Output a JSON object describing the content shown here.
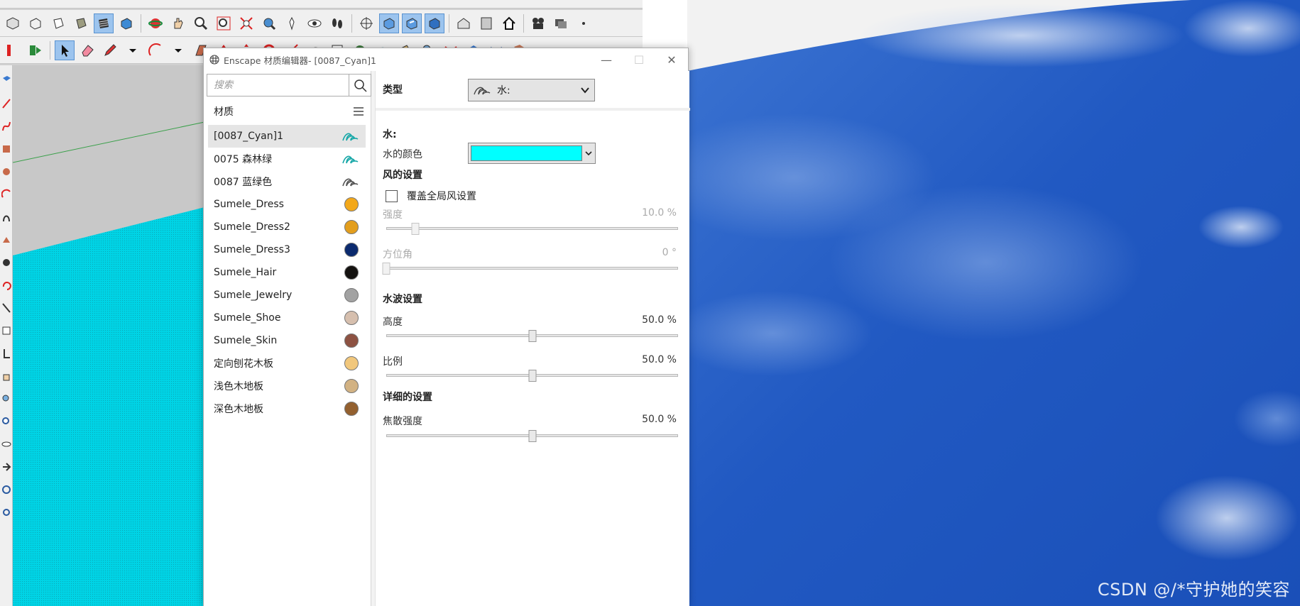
{
  "editor": {
    "title": "Enscape 材质编辑器- [0087_Cyan]1",
    "minimize": "—",
    "maximize": "☐",
    "close": "✕"
  },
  "search": {
    "placeholder": "搜索"
  },
  "materials": {
    "header": "材质",
    "items": [
      {
        "name": "[0087_Cyan]1",
        "icon": "wave-icon",
        "color": "#19a8a8",
        "selected": true
      },
      {
        "name": "0075 森林绿",
        "icon": "wave-icon",
        "color": "#19a8a8",
        "selected": false
      },
      {
        "name": "0087 蓝绿色",
        "icon": "wave-icon",
        "color": "#555555",
        "selected": false
      },
      {
        "name": "Sumele_Dress",
        "icon": "swatch",
        "color": "#f3a81a",
        "selected": false
      },
      {
        "name": "Sumele_Dress2",
        "icon": "swatch",
        "color": "#e39e1d",
        "selected": false
      },
      {
        "name": "Sumele_Dress3",
        "icon": "swatch",
        "color": "#0b2a6e",
        "selected": false
      },
      {
        "name": "Sumele_Hair",
        "icon": "swatch",
        "color": "#141210",
        "selected": false
      },
      {
        "name": "Sumele_Jewelry",
        "icon": "swatch",
        "color": "#a2a2a2",
        "selected": false
      },
      {
        "name": "Sumele_Shoe",
        "icon": "swatch",
        "color": "#d6bfae",
        "selected": false
      },
      {
        "name": "Sumele_Skin",
        "icon": "swatch",
        "color": "#8d5242",
        "selected": false
      },
      {
        "name": "定向刨花木板",
        "icon": "swatch",
        "color": "#f1c77c",
        "selected": false
      },
      {
        "name": "浅色木地板",
        "icon": "swatch",
        "color": "#d2b283",
        "selected": false
      },
      {
        "name": "深色木地板",
        "icon": "swatch",
        "color": "#93602f",
        "selected": false
      }
    ]
  },
  "properties": {
    "type_label": "类型",
    "type_value": "水:",
    "water_section": "水:",
    "water_color_label": "水的颜色",
    "water_color": "#00ffff",
    "wind_section": "风的设置",
    "override_wind_label": "覆盖全局风设置",
    "override_wind_checked": false,
    "strength_label": "强度",
    "strength_value": "10.0 %",
    "strength_fraction": 0.1,
    "azimuth_label": "方位角",
    "azimuth_value": "0 °",
    "azimuth_fraction": 0.0,
    "wave_section": "水波设置",
    "height_label": "高度",
    "height_value": "50.0 %",
    "height_fraction": 0.5,
    "scale_label": "比例",
    "scale_value": "50.0 %",
    "scale_fraction": 0.5,
    "detail_section": "详细的设置",
    "caustics_label": "焦散强度",
    "caustics_value": "50.0 %",
    "caustics_fraction": 0.5
  },
  "render": {
    "watermark": "CSDN @/*守护她的笑容",
    "water_color": "#1a56c4"
  },
  "sketchup": {
    "viewport_fill": "#00d4e6"
  }
}
